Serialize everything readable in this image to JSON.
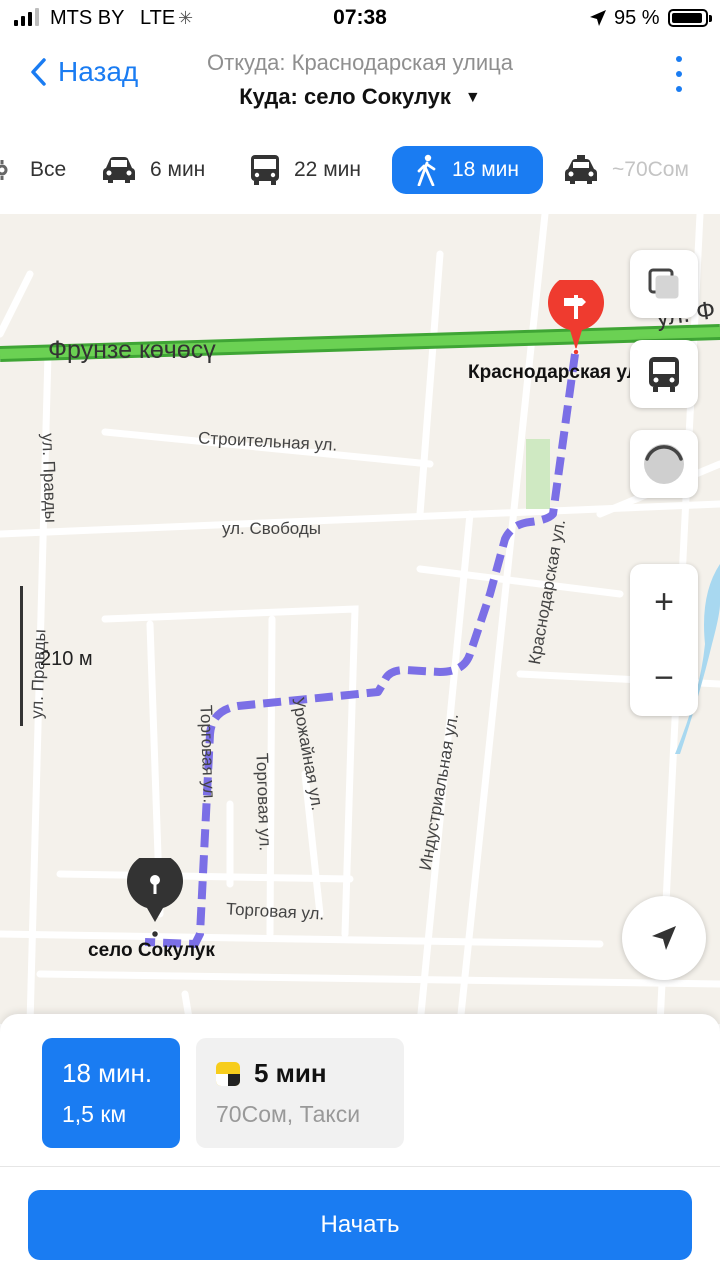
{
  "status_bar": {
    "carrier": "MTS BY",
    "network": "LTE",
    "time": "07:38",
    "battery_percent": "95 %",
    "battery_level": 0.95
  },
  "header": {
    "back_label": "Назад",
    "from": "Откуда: Краснодарская улица",
    "to": "Куда: село Сокулук"
  },
  "modes": [
    {
      "label": "Все",
      "icon": "all-modes-icon"
    },
    {
      "label": "6 мин",
      "icon": "car-icon"
    },
    {
      "label": "22 мин",
      "icon": "bus-icon"
    },
    {
      "label": "18 мин",
      "icon": "pedestrian-icon",
      "active": true
    },
    {
      "label": "~70Сом",
      "icon": "taxi-icon"
    }
  ],
  "map": {
    "main_street": "Фрунзе көчөсү",
    "main_street_east": "ул. Ф",
    "origin_label": "Краснодарская ул",
    "destination_label": "село Сокулук",
    "scale": "210 м",
    "streets": {
      "stroitelnaya": "Строительная ул.",
      "svobody": "ул. Свободы",
      "pravdy_top": "ул. Правды",
      "pravdy_bottom": "ул. Правды",
      "krasnodarskaya": "Краснодарская ул.",
      "industrialnaya": "Индустриальная ул.",
      "urozhaynaya": "Урожайная ул.",
      "torgovaya_vertical": "Торговая ул.",
      "torgovaya_vertical2": "Торговая ул.",
      "torgovaya_horizontal": "Торговая ул."
    },
    "controls": {
      "zoom_in": "+",
      "zoom_out": "−"
    }
  },
  "sheet": {
    "walk_time": "18 мин.",
    "walk_distance": "1,5 км",
    "taxi_time": "5 мин",
    "taxi_detail": "70Сом, Такси",
    "start_label": "Начать"
  },
  "colors": {
    "accent": "#1a7cf2",
    "route": "#7b6fe6",
    "main_road": "#5cc34b",
    "pin_start": "#ef3b2f",
    "pin_end": "#333333"
  }
}
